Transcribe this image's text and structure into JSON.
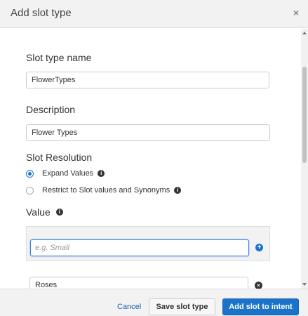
{
  "dialog": {
    "title": "Add slot type",
    "close_glyph": "×"
  },
  "form": {
    "slot_type_name": {
      "label": "Slot type name",
      "value": "FlowerTypes"
    },
    "description": {
      "label": "Description",
      "value": "Flower Types"
    },
    "slot_resolution": {
      "label": "Slot Resolution",
      "options": [
        {
          "label": "Expand Values",
          "selected": true
        },
        {
          "label": "Restrict to Slot values and Synonyms",
          "selected": false
        }
      ]
    },
    "value": {
      "label": "Value",
      "placeholder": "e.g. Small",
      "add_glyph": "+",
      "entries": [
        {
          "value": "Roses",
          "remove_glyph": "×"
        }
      ]
    }
  },
  "footer": {
    "cancel_label": "Cancel",
    "save_label": "Save slot type",
    "add_label": "Add slot to intent"
  },
  "icons": {
    "info": "i",
    "accent_color": "#1a73c9"
  }
}
